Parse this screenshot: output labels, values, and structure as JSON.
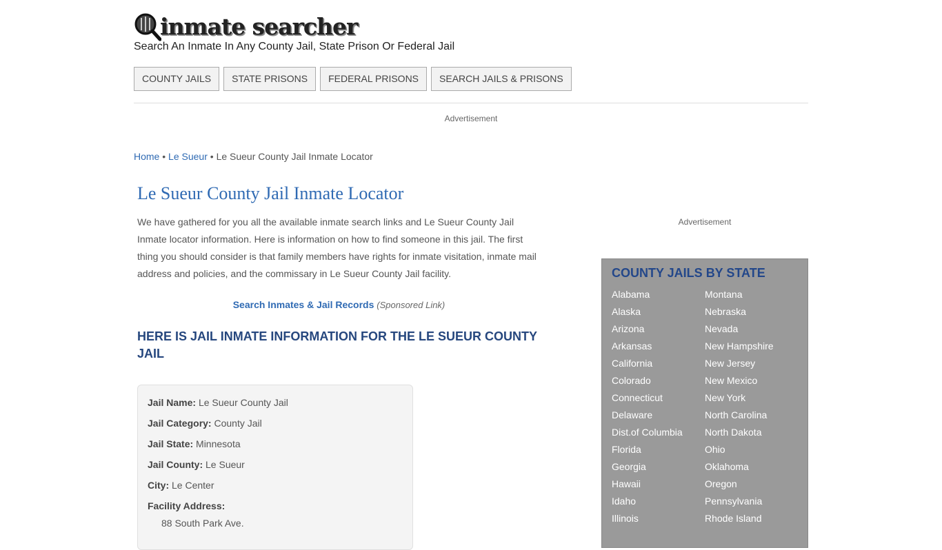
{
  "header": {
    "logo_text": "inmate searcher",
    "tagline": "Search An Inmate In Any County Jail, State Prison Or Federal Jail"
  },
  "nav": {
    "items": [
      "COUNTY JAILS",
      "STATE PRISONS",
      "FEDERAL PRISONS",
      "SEARCH JAILS & PRISONS"
    ]
  },
  "ads": {
    "top_label": "Advertisement",
    "side_label": "Advertisement"
  },
  "breadcrumb": {
    "home": "Home",
    "sep": "•",
    "county": "Le Sueur",
    "current": "Le Sueur County Jail Inmate Locator"
  },
  "main": {
    "title": "Le Sueur County Jail Inmate Locator",
    "intro": "We have gathered for you all the available inmate search links and Le Sueur County Jail Inmate locator information. Here is information on how to find someone in this jail. The first thing you should consider is that family members have rights for inmate visitation, inmate mail address and policies, and the commissary in Le Sueur County Jail facility.",
    "sponsored_link": "Search Inmates & Jail Records",
    "sponsored_note": "(Sponsored Link)",
    "section_heading": "HERE IS JAIL INMATE INFORMATION FOR THE LE SUEUR COUNTY JAIL"
  },
  "info": {
    "name_label": "Jail Name:",
    "name": "Le Sueur County Jail",
    "category_label": "Jail Category:",
    "category": "County Jail",
    "state_label": "Jail State:",
    "state": "Minnesota",
    "county_label": "Jail County:",
    "county": "Le Sueur",
    "city_label": "City:",
    "city": "Le Center",
    "address_label": "Facility Address:",
    "address": "88 South Park Ave."
  },
  "sidebar": {
    "title": "COUNTY JAILS BY STATE",
    "states": [
      [
        "Alabama",
        "Montana"
      ],
      [
        "Alaska",
        "Nebraska"
      ],
      [
        "Arizona",
        "Nevada"
      ],
      [
        "Arkansas",
        "New Hampshire"
      ],
      [
        "California",
        "New Jersey"
      ],
      [
        "Colorado",
        "New Mexico"
      ],
      [
        "Connecticut",
        "New York"
      ],
      [
        "Delaware",
        "North Carolina"
      ],
      [
        "Dist.of Columbia",
        "North Dakota"
      ],
      [
        "Florida",
        "Ohio"
      ],
      [
        "Georgia",
        "Oklahoma"
      ],
      [
        "Hawaii",
        "Oregon"
      ],
      [
        "Idaho",
        "Pennsylvania"
      ],
      [
        "Illinois",
        "Rhode Island"
      ]
    ]
  }
}
